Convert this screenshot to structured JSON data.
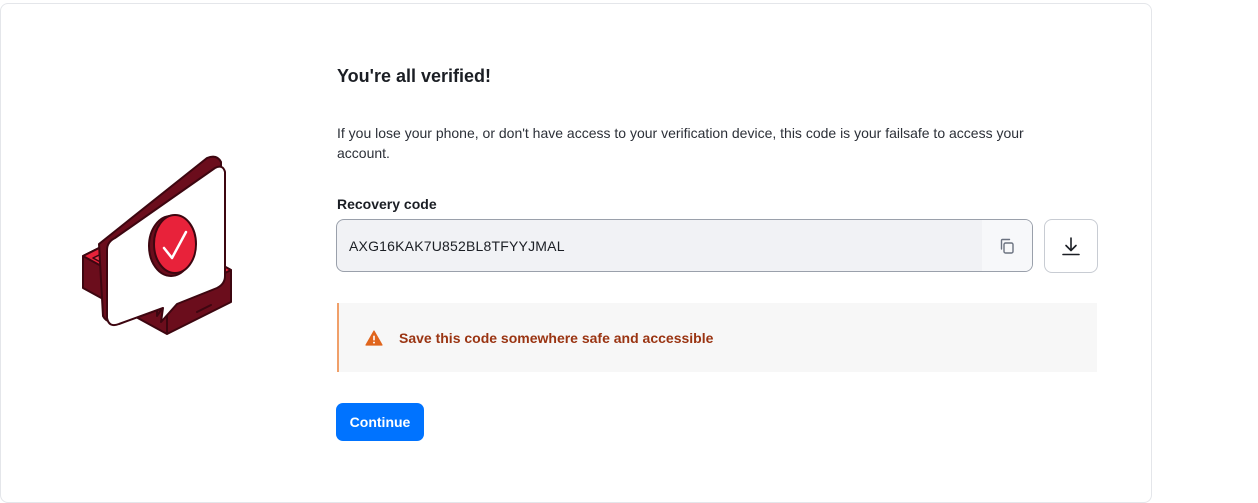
{
  "title": "You're all verified!",
  "description": "If you lose your phone, or don't have access to your verification device, this code is your failsafe to access your account.",
  "recovery": {
    "label": "Recovery code",
    "code": "AXG16KAK7U852BL8TFYYJMAL",
    "copy_icon": "copy-icon",
    "download_icon": "download-icon"
  },
  "alert": {
    "icon": "warning-triangle-icon",
    "text": "Save this code somewhere safe and accessible"
  },
  "actions": {
    "continue_label": "Continue"
  },
  "colors": {
    "primary": "#0073ff",
    "illustration_red": "#e8223a",
    "illustration_dark": "#6b0d1c",
    "warning_text": "#9a3412",
    "warning_icon": "#e0651d",
    "alert_border": "#f0a06a"
  }
}
